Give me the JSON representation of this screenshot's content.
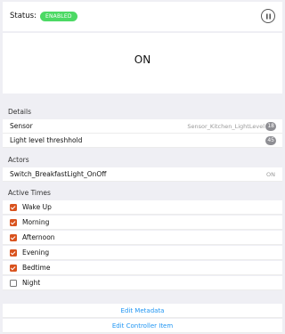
{
  "status": {
    "label": "Status:",
    "badge": "ENABLED",
    "badge_color": "#4cd964"
  },
  "value_card": {
    "value": "ON"
  },
  "details": {
    "title": "Details",
    "rows": [
      {
        "label": "Sensor",
        "value": "Sensor_Kitchen_LightLevel",
        "badge": "18"
      },
      {
        "label": "Light level threshhold",
        "badge": "45"
      }
    ]
  },
  "actors": {
    "title": "Actors",
    "rows": [
      {
        "label": "Switch_BreakfastLight_OnOff",
        "value": "ON"
      }
    ]
  },
  "active_times": {
    "title": "Active Times",
    "items": [
      {
        "label": "Wake Up",
        "checked": true
      },
      {
        "label": "Morning",
        "checked": true
      },
      {
        "label": "Afternoon",
        "checked": true
      },
      {
        "label": "Evening",
        "checked": true
      },
      {
        "label": "Bedtime",
        "checked": true
      },
      {
        "label": "Night",
        "checked": false
      }
    ]
  },
  "links": {
    "edit_metadata": "Edit Metadata",
    "edit_controller": "Edit Controller Item"
  },
  "colors": {
    "accent_checkbox": "#d9531e",
    "link": "#2196f3"
  }
}
